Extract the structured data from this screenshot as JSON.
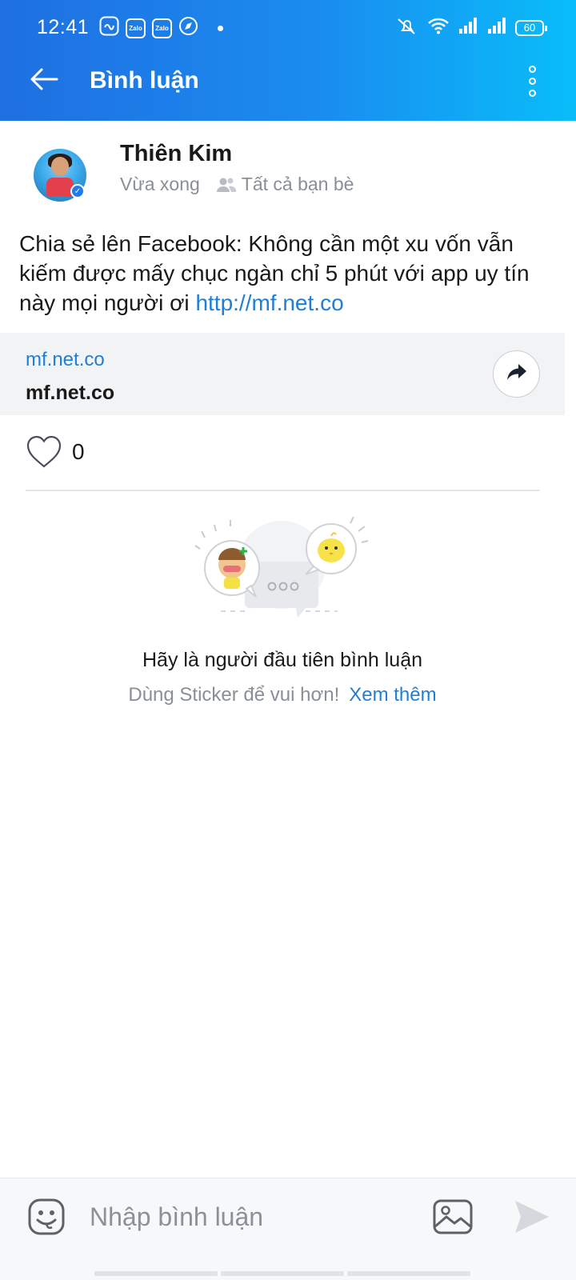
{
  "status_bar": {
    "time": "12:41",
    "app_icons": [
      "chat-bubble-icon",
      "Zalo",
      "Zalo",
      "compass-icon"
    ],
    "battery": "60"
  },
  "app_bar": {
    "title": "Bình luận",
    "back_icon": "arrow-left-icon",
    "more_icon": "more-vertical-icon"
  },
  "post": {
    "author": "Thiên Kim",
    "time": "Vừa xong",
    "audience": "Tất cả bạn bè",
    "text": "Chia sẻ lên Facebook: Không cần một xu vốn vẫn kiếm được mấy chục ngàn chỉ 5 phút với app uy tín này mọi người ơi ",
    "link_text": "http://mf.net.co",
    "preview": {
      "domain": "mf.net.co",
      "title": "mf.net.co"
    },
    "like_count": "0"
  },
  "empty_state": {
    "title": "Hãy là người đầu tiên bình luận",
    "subtitle": "Dùng Sticker để vui hơn!",
    "see_more": "Xem thêm"
  },
  "composer": {
    "placeholder": "Nhập bình luận"
  },
  "colors": {
    "accent": "#1f7ed6",
    "header_start": "#1f6fe0",
    "header_end": "#09bdf9"
  }
}
